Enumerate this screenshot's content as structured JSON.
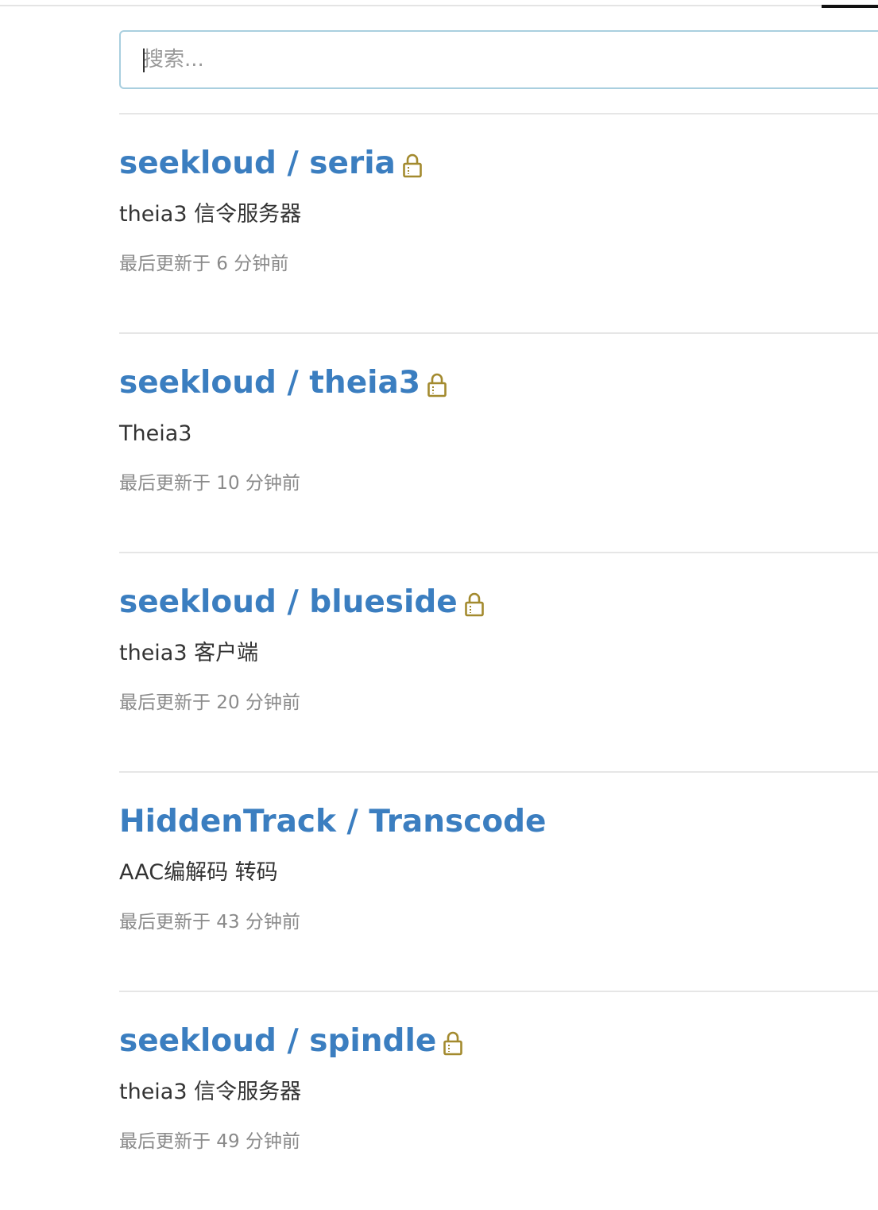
{
  "search": {
    "placeholder": "搜索..."
  },
  "icons": {
    "lock": "lock-icon",
    "lock_color": "#a38a2e"
  },
  "colors": {
    "title": "#3b7ec0",
    "description": "#333333",
    "meta": "#8a8a8a"
  },
  "repos": [
    {
      "title": "seekloud / seria",
      "private": true,
      "description": "theia3 信令服务器",
      "updated": "最后更新于 6 分钟前"
    },
    {
      "title": "seekloud / theia3",
      "private": true,
      "description": "Theia3",
      "updated": "最后更新于 10 分钟前"
    },
    {
      "title": "seekloud / blueside",
      "private": true,
      "description": "theia3 客户端",
      "updated": "最后更新于 20 分钟前"
    },
    {
      "title": "HiddenTrack / Transcode",
      "private": false,
      "description": "AAC编解码 转码",
      "updated": "最后更新于 43 分钟前"
    },
    {
      "title": "seekloud / spindle",
      "private": true,
      "description": "theia3 信令服务器",
      "updated": "最后更新于 49 分钟前"
    }
  ]
}
